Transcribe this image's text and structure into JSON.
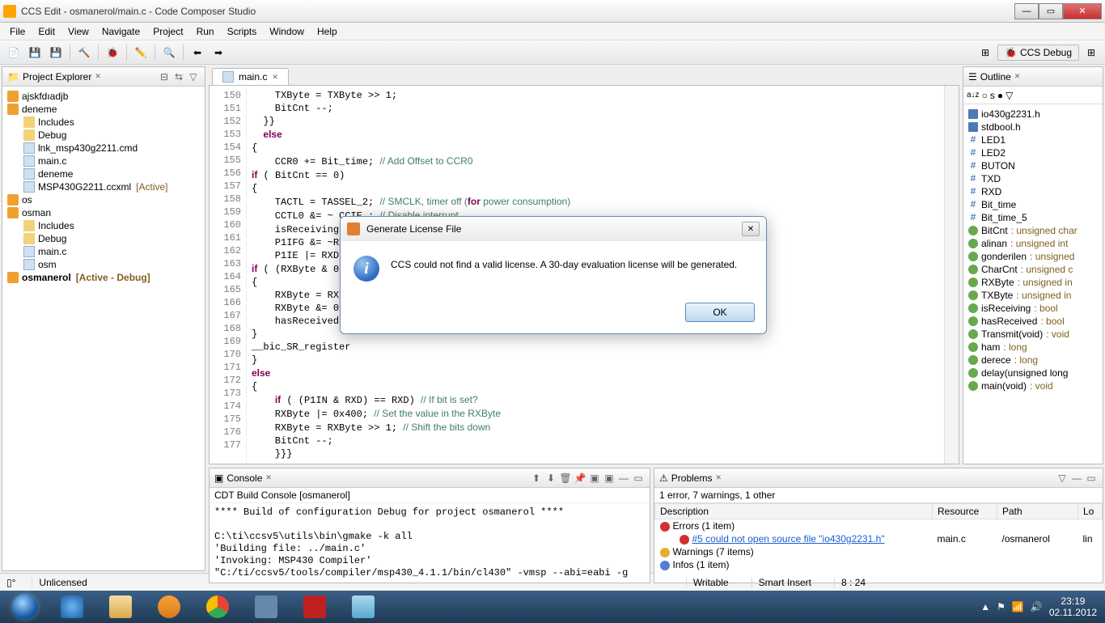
{
  "window": {
    "title": "CCS Edit - osmanerol/main.c - Code Composer Studio"
  },
  "menubar": [
    "File",
    "Edit",
    "View",
    "Navigate",
    "Project",
    "Run",
    "Scripts",
    "Window",
    "Help"
  ],
  "perspective": {
    "label": "CCS Debug"
  },
  "projectExplorer": {
    "title": "Project Explorer",
    "items": [
      {
        "level": 0,
        "icon": "ccs",
        "label": "ajskfdıadjb"
      },
      {
        "level": 0,
        "icon": "ccs",
        "label": "deneme"
      },
      {
        "level": 1,
        "icon": "folder",
        "label": "Includes"
      },
      {
        "level": 1,
        "icon": "folder",
        "label": "Debug"
      },
      {
        "level": 1,
        "icon": "file",
        "label": "lnk_msp430g2211.cmd"
      },
      {
        "level": 1,
        "icon": "c",
        "label": "main.c"
      },
      {
        "level": 1,
        "icon": "file",
        "label": "deneme"
      },
      {
        "level": 1,
        "icon": "file",
        "label": "MSP430G2211.ccxml",
        "suffix": "[Active]"
      },
      {
        "level": 0,
        "icon": "ccs",
        "label": "os"
      },
      {
        "level": 0,
        "icon": "ccs",
        "label": "osman"
      },
      {
        "level": 1,
        "icon": "folder",
        "label": "Includes"
      },
      {
        "level": 1,
        "icon": "folder",
        "label": "Debug"
      },
      {
        "level": 1,
        "icon": "c",
        "label": "main.c"
      },
      {
        "level": 1,
        "icon": "file",
        "label": "osm"
      },
      {
        "level": 0,
        "icon": "ccs",
        "label": "osmanerol",
        "suffix": "[Active - Debug]",
        "bold": true
      }
    ]
  },
  "editor": {
    "tab": "main.c",
    "startLine": 150,
    "code": "    TXByte = TXByte >> 1;\n    BitCnt --;\n  }}\n  else\n{\n    CCR0 += Bit_time; // Add Offset to CCR0\nif ( BitCnt == 0)\n{\n    TACTL = TASSEL_2; // SMCLK, timer off (for power consumption)\n    CCTL0 &= ~ CCIE ; // Disable interrupt\n    isReceiving = false;\n    P1IFG &= ~RXD\n    P1IE |= RXD;\nif ( (RXByte & 0x\n{\n    RXByte = RXByt\n    RXByte &= 0xF\n    hasReceived =\n}\n__bic_SR_register\n}\nelse\n{\n    if ( (P1IN & RXD) == RXD) // If bit is set?\n    RXByte |= 0x400; // Set the value in the RXByte\n    RXByte = RXByte >> 1; // Shift the bits down\n    BitCnt --;\n    }}}"
  },
  "outline": {
    "title": "Outline",
    "items": [
      {
        "icon": "inc",
        "label": "io430g2231.h"
      },
      {
        "icon": "inc",
        "label": "stdbool.h"
      },
      {
        "icon": "hash",
        "label": "LED1"
      },
      {
        "icon": "hash",
        "label": "LED2"
      },
      {
        "icon": "hash",
        "label": "BUTON"
      },
      {
        "icon": "hash",
        "label": "TXD"
      },
      {
        "icon": "hash",
        "label": "RXD"
      },
      {
        "icon": "hash",
        "label": "Bit_time"
      },
      {
        "icon": "hash",
        "label": "Bit_time_5"
      },
      {
        "icon": "var",
        "label": "BitCnt",
        "type": ": unsigned char"
      },
      {
        "icon": "var",
        "label": "alinan",
        "type": ": unsigned int"
      },
      {
        "icon": "var",
        "label": "gonderilen",
        "type": ": unsigned"
      },
      {
        "icon": "var",
        "label": "CharCnt",
        "type": ": unsigned c"
      },
      {
        "icon": "var",
        "label": "RXByte",
        "type": ": unsigned in"
      },
      {
        "icon": "var",
        "label": "TXByte",
        "type": ": unsigned in"
      },
      {
        "icon": "var",
        "label": "isReceiving",
        "type": ": bool"
      },
      {
        "icon": "var",
        "label": "hasReceived",
        "type": ": bool"
      },
      {
        "icon": "func",
        "label": "Transmit(void)",
        "type": ": void"
      },
      {
        "icon": "var",
        "label": "ham",
        "type": ": long"
      },
      {
        "icon": "var",
        "label": "derece",
        "type": ": long"
      },
      {
        "icon": "func",
        "label": "delay(unsigned long"
      },
      {
        "icon": "func",
        "label": "main(void)",
        "type": ": void"
      }
    ]
  },
  "console": {
    "title": "Console",
    "subtitle": "CDT Build Console [osmanerol]",
    "text": "**** Build of configuration Debug for project osmanerol ****\n\nC:\\ti\\ccsv5\\utils\\bin\\gmake -k all\n'Building file: ../main.c'\n'Invoking: MSP430 Compiler'\n\"C:/ti/ccsv5/tools/compiler/msp430_4.1.1/bin/cl430\" -vmsp --abi=eabi -g"
  },
  "problems": {
    "title": "Problems",
    "summary": "1 error, 7 warnings, 1 other",
    "headers": [
      "Description",
      "Resource",
      "Path",
      "Lo"
    ],
    "rows": [
      {
        "icon": "err",
        "desc": "Errors (1 item)",
        "res": "",
        "path": ""
      },
      {
        "icon": "err",
        "desc": "#5  could not open source file \"io430g2231.h\"",
        "res": "main.c",
        "path": "/osmanerol",
        "loc": "lin",
        "indent": true,
        "link": true
      },
      {
        "icon": "warn",
        "desc": "Warnings (7 items)",
        "res": "",
        "path": ""
      },
      {
        "icon": "info",
        "desc": "Infos (1 item)",
        "res": "",
        "path": ""
      }
    ]
  },
  "statusbar": {
    "license": "Unlicensed",
    "writable": "Writable",
    "insert": "Smart Insert",
    "pos": "8 : 24"
  },
  "dialog": {
    "title": "Generate License File",
    "message": "CCS could not find a valid license. A 30-day evaluation license will be generated.",
    "ok": "OK"
  },
  "taskbar": {
    "time": "23:19",
    "date": "02.11.2012"
  }
}
